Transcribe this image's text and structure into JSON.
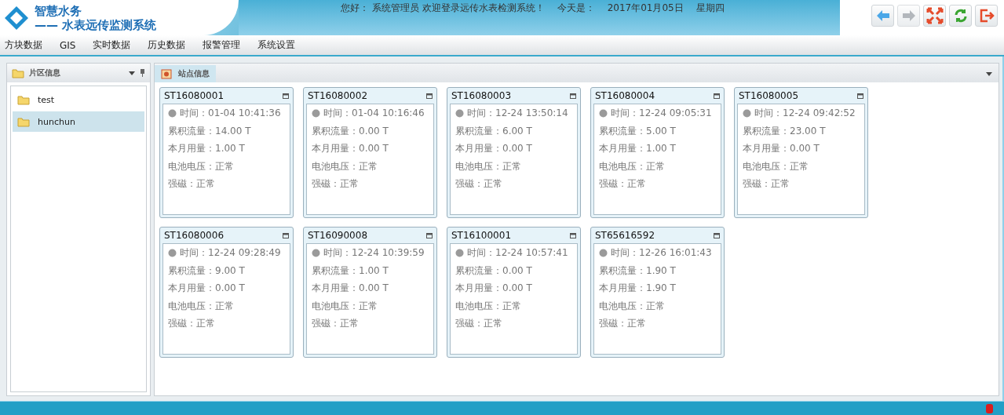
{
  "header": {
    "brand": "智慧水务",
    "subtitle": "—— 水表远传监测系统",
    "greeting": "您好： 系统管理员   欢迎登录远传水表检测系统！",
    "today_label": "今天是：",
    "date": "2017年01月05日",
    "weekday": "星期四"
  },
  "toolbar": [
    {
      "kind": "back",
      "disabled": false
    },
    {
      "kind": "forward",
      "disabled": true
    },
    {
      "kind": "fullscreen",
      "disabled": false
    },
    {
      "kind": "refresh",
      "disabled": false
    },
    {
      "kind": "logout",
      "disabled": false
    }
  ],
  "menu": [
    {
      "label": "方块数据"
    },
    {
      "label": "GIS"
    },
    {
      "label": "实时数据"
    },
    {
      "label": "历史数据"
    },
    {
      "label": "报警管理"
    },
    {
      "label": "系统设置"
    }
  ],
  "sidebar": {
    "title": "片区信息",
    "items": [
      {
        "label": "test",
        "selected": false
      },
      {
        "label": "hunchun",
        "selected": true
      }
    ]
  },
  "tab": {
    "label": "站点信息"
  },
  "stations": [
    {
      "id": "ST16080001",
      "time": "时间：01-04 10:41:36",
      "lines": [
        "累积流量：14.00 T",
        "本月用量：1.00 T",
        "电池电压：正常",
        "强磁：正常"
      ]
    },
    {
      "id": "ST16080002",
      "time": "时间：01-04 10:16:46",
      "lines": [
        "累积流量：0.00 T",
        "本月用量：0.00 T",
        "电池电压：正常",
        "强磁：正常"
      ]
    },
    {
      "id": "ST16080003",
      "time": "时间：12-24 13:50:14",
      "lines": [
        "累积流量：6.00 T",
        "本月用量：0.00 T",
        "电池电压：正常",
        "强磁：正常"
      ]
    },
    {
      "id": "ST16080004",
      "time": "时间：12-24 09:05:31",
      "lines": [
        "累积流量：5.00 T",
        "本月用量：1.00 T",
        "电池电压：正常",
        "强磁：正常"
      ]
    },
    {
      "id": "ST16080005",
      "time": "时间：12-24 09:42:52",
      "lines": [
        "累积流量：23.00 T",
        "本月用量：0.00 T",
        "电池电压：正常",
        "强磁：正常"
      ]
    },
    {
      "id": "ST16080006",
      "time": "时间：12-24 09:28:49",
      "lines": [
        "累积流量：9.00 T",
        "本月用量：0.00 T",
        "电池电压：正常",
        "强磁：正常"
      ]
    },
    {
      "id": "ST16090008",
      "time": "时间：12-24 10:39:59",
      "lines": [
        "累积流量：1.00 T",
        "本月用量：0.00 T",
        "电池电压：正常",
        "强磁：正常"
      ]
    },
    {
      "id": "ST16100001",
      "time": "时间：12-24 10:57:41",
      "lines": [
        "累积流量：0.00 T",
        "本月用量：0.00 T",
        "电池电压：正常",
        "强磁：正常"
      ]
    },
    {
      "id": "ST65616592",
      "time": "时间：12-26 16:01:43",
      "lines": [
        "累积流量：1.90 T",
        "本月用量：1.90 T",
        "电池电压：正常",
        "强磁：正常"
      ]
    }
  ]
}
